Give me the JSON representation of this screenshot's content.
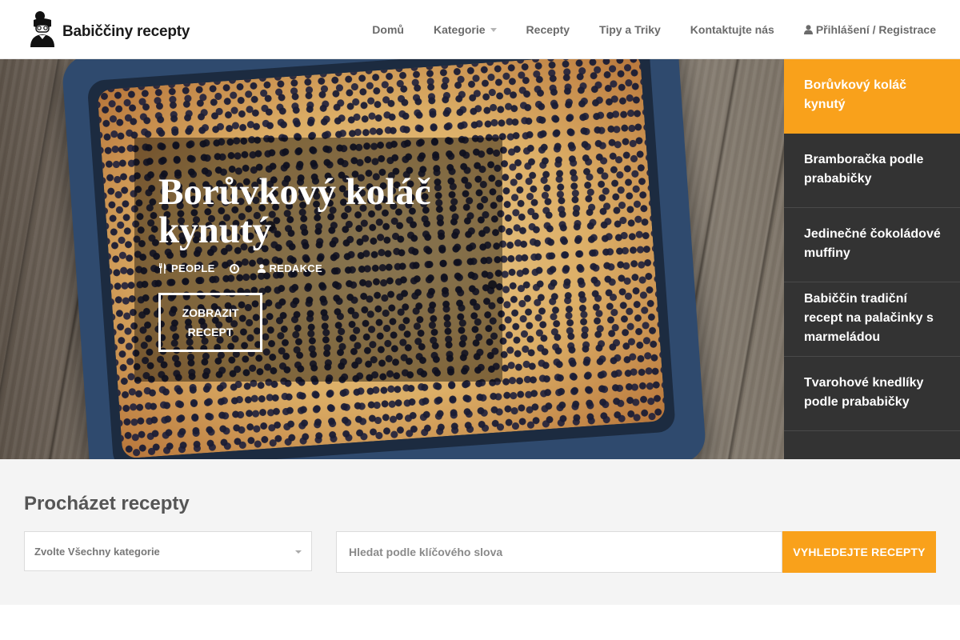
{
  "header": {
    "logo_text": "Babiččiny recepty",
    "nav": {
      "home": "Domů",
      "categories": "Kategorie",
      "recipes": "Recepty",
      "tips": "Tipy a Triky",
      "contact": "Kontaktujte nás",
      "login": "Přihlášení / Registrace"
    }
  },
  "hero": {
    "title": "Borůvkový koláč kynutý",
    "meta_people": "PEOPLE",
    "meta_author": "REDAKCE",
    "button": "ZOBRAZIT RECEPT"
  },
  "sidebar": {
    "items": [
      {
        "label": "Borůvkový koláč kynutý"
      },
      {
        "label": "Bramboračka podle prababičky"
      },
      {
        "label": "Jedinečné čokoládové muffiny"
      },
      {
        "label": "Babiččin tradiční recept na palačinky s marmeládou"
      },
      {
        "label": "Tvarohové knedlíky podle prababičky"
      }
    ]
  },
  "search": {
    "title": "Procházet recepty",
    "category_select": "Zvolte Všechny kategorie",
    "keyword_placeholder": "Hledat podle klíčového slova",
    "button": "VYHLEDEJTE RECEPTY"
  },
  "colors": {
    "accent": "#f9a11b",
    "sidebar_bg": "#333333",
    "search_bg": "#f4f4f4"
  }
}
